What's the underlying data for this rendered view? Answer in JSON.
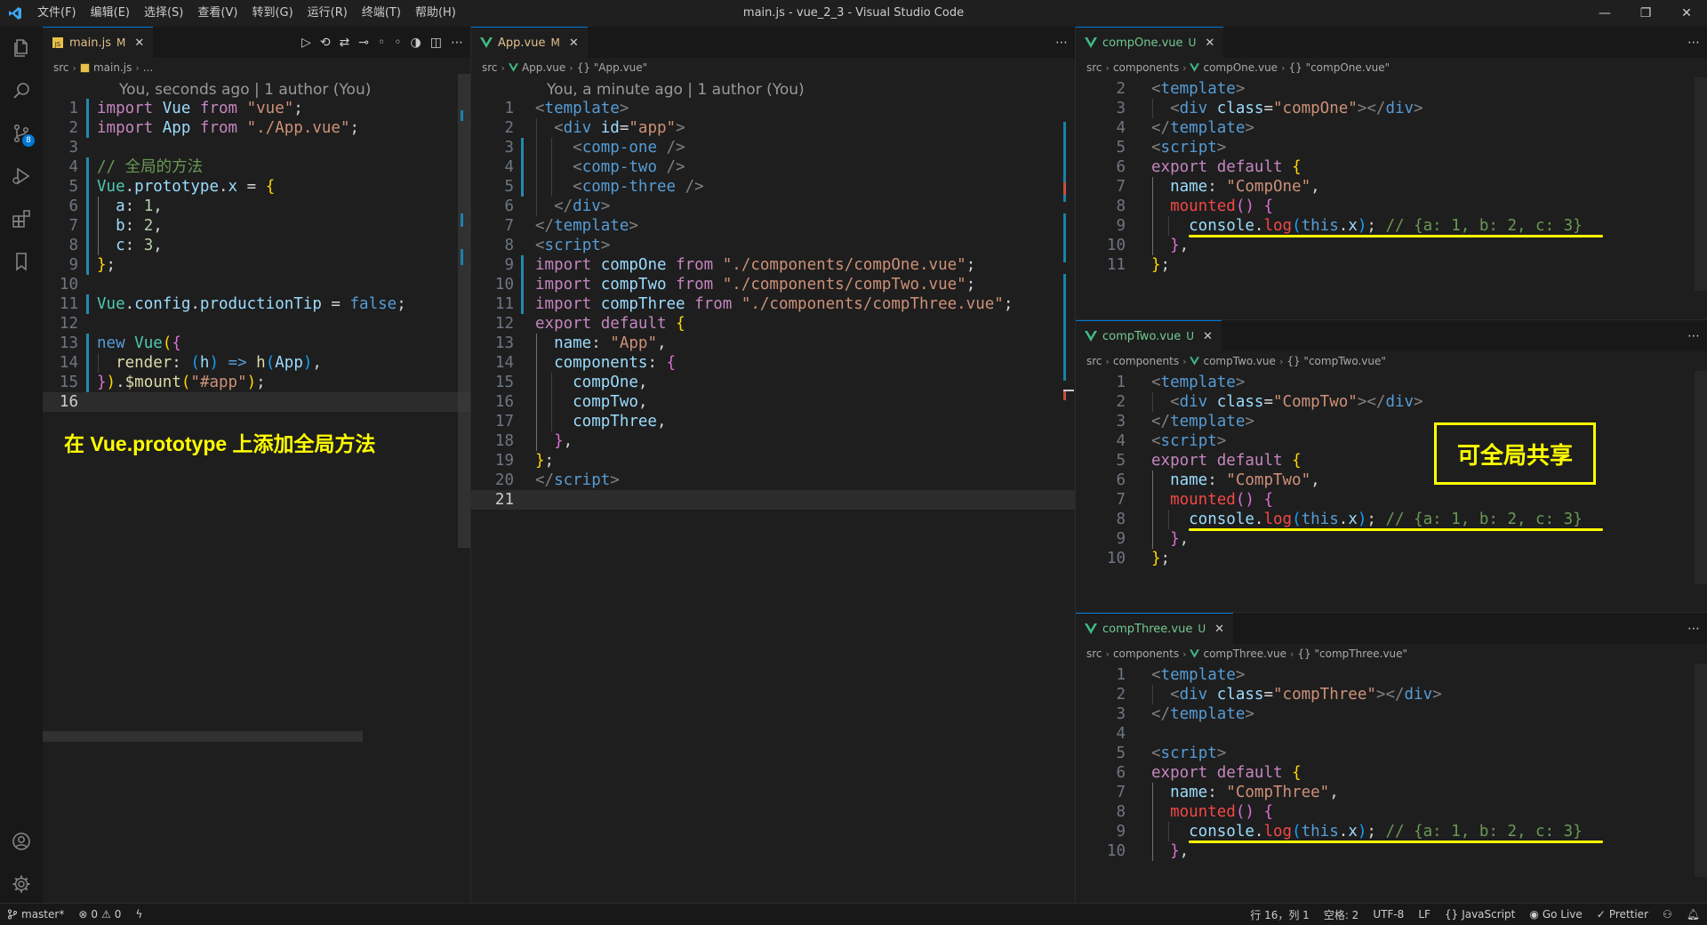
{
  "titlebar": {
    "menu": [
      "文件(F)",
      "编辑(E)",
      "选择(S)",
      "查看(V)",
      "转到(G)",
      "运行(R)",
      "终端(T)",
      "帮助(H)"
    ],
    "title": "main.js - vue_2_3 - Visual Studio Code",
    "minimize": "—",
    "maximize": "❐",
    "close": "✕"
  },
  "activity": {
    "icons": [
      "files-icon",
      "search-icon",
      "source-control-icon",
      "run-debug-icon",
      "extensions-icon",
      "bookmark-icon",
      "account-icon",
      "settings-gear-icon"
    ],
    "scm_badge": "8"
  },
  "left": {
    "tab": {
      "name": "main.js",
      "status": "M",
      "close": "✕"
    },
    "crumbs": [
      "src",
      "main.js",
      "..."
    ],
    "lens": "You, seconds ago | 1 author (You)",
    "lines": [
      [
        [
          "import ",
          "t-kw"
        ],
        [
          "Vue ",
          "t-var"
        ],
        [
          "from ",
          "t-kw"
        ],
        [
          "\"vue\"",
          "t-str"
        ],
        [
          ";",
          "t-w"
        ]
      ],
      [
        [
          "import ",
          "t-kw"
        ],
        [
          "App ",
          "t-var"
        ],
        [
          "from ",
          "t-kw"
        ],
        [
          "\"./App.vue\"",
          "t-str"
        ],
        [
          ";",
          "t-w"
        ]
      ],
      [],
      [
        [
          "// 全局的方法",
          "t-com"
        ]
      ],
      [
        [
          "Vue",
          "t-ty"
        ],
        [
          ".",
          "t-w"
        ],
        [
          "prototype",
          "t-var"
        ],
        [
          ".",
          "t-w"
        ],
        [
          "x",
          "t-var"
        ],
        [
          " = ",
          "t-w"
        ],
        [
          "{",
          "t-y"
        ]
      ],
      [
        [
          "  a",
          "t-var"
        ],
        [
          ": ",
          "t-w"
        ],
        [
          "1",
          "t-num"
        ],
        [
          ",",
          "t-w"
        ]
      ],
      [
        [
          "  b",
          "t-var"
        ],
        [
          ": ",
          "t-w"
        ],
        [
          "2",
          "t-num"
        ],
        [
          ",",
          "t-w"
        ]
      ],
      [
        [
          "  c",
          "t-var"
        ],
        [
          ": ",
          "t-w"
        ],
        [
          "3",
          "t-num"
        ],
        [
          ",",
          "t-w"
        ]
      ],
      [
        [
          "}",
          "t-y"
        ],
        [
          ";",
          "t-w"
        ]
      ],
      [],
      [
        [
          "Vue",
          "t-ty"
        ],
        [
          ".",
          "t-w"
        ],
        [
          "config",
          "t-var"
        ],
        [
          ".",
          "t-w"
        ],
        [
          "productionTip",
          "t-var"
        ],
        [
          " = ",
          "t-w"
        ],
        [
          "false",
          "t-blue"
        ],
        [
          ";",
          "t-w"
        ]
      ],
      [],
      [
        [
          "new ",
          "t-blue"
        ],
        [
          "Vue",
          "t-ty"
        ],
        [
          "(",
          "t-y"
        ],
        [
          "{",
          "t-pk"
        ]
      ],
      [
        [
          "  render",
          "t-fn"
        ],
        [
          ": ",
          "t-w"
        ],
        [
          "(",
          "t-bl"
        ],
        [
          "h",
          "t-var"
        ],
        [
          ")",
          "t-bl"
        ],
        [
          " => ",
          "t-blue"
        ],
        [
          "h",
          "t-fn"
        ],
        [
          "(",
          "t-bl"
        ],
        [
          "App",
          "t-var"
        ],
        [
          ")",
          "t-bl"
        ],
        [
          ",",
          "t-w"
        ]
      ],
      [
        [
          "}",
          "t-pk"
        ],
        [
          ")",
          "t-y"
        ],
        [
          ".",
          "t-w"
        ],
        [
          "$mount",
          "t-fn"
        ],
        [
          "(",
          "t-y"
        ],
        [
          "\"#app\"",
          "t-str"
        ],
        [
          ")",
          "t-y"
        ],
        [
          ";",
          "t-w"
        ]
      ],
      []
    ],
    "current_line": 16,
    "annotation": "在 Vue.prototype 上添加全局方法"
  },
  "middle": {
    "tab": {
      "name": "App.vue",
      "status": "M",
      "close": "✕"
    },
    "crumbs": [
      "src",
      "App.vue",
      "{} \"App.vue\""
    ],
    "lens": "You, a minute ago | 1 author (You)",
    "lines": [
      [
        [
          "<",
          "t-br"
        ],
        [
          "template",
          "t-tag"
        ],
        [
          ">",
          "t-br"
        ]
      ],
      [
        [
          "  <",
          "t-br"
        ],
        [
          "div ",
          "t-tag"
        ],
        [
          "id",
          "t-attr"
        ],
        [
          "=",
          "t-w"
        ],
        [
          "\"app\"",
          "t-str"
        ],
        [
          ">",
          "t-br"
        ]
      ],
      [
        [
          "    <",
          "t-br"
        ],
        [
          "comp-one ",
          "t-tag"
        ],
        [
          "/>",
          "t-br"
        ]
      ],
      [
        [
          "    <",
          "t-br"
        ],
        [
          "comp-two ",
          "t-tag"
        ],
        [
          "/>",
          "t-br"
        ]
      ],
      [
        [
          "    <",
          "t-br"
        ],
        [
          "comp-three ",
          "t-tag"
        ],
        [
          "/>",
          "t-br"
        ]
      ],
      [
        [
          "  </",
          "t-br"
        ],
        [
          "div",
          "t-tag"
        ],
        [
          ">",
          "t-br"
        ]
      ],
      [
        [
          "</",
          "t-br"
        ],
        [
          "template",
          "t-tag"
        ],
        [
          ">",
          "t-br"
        ]
      ],
      [
        [
          "<",
          "t-br"
        ],
        [
          "script",
          "t-tag"
        ],
        [
          ">",
          "t-br"
        ]
      ],
      [
        [
          "import ",
          "t-kw"
        ],
        [
          "compOne ",
          "t-var"
        ],
        [
          "from ",
          "t-kw"
        ],
        [
          "\"./components/compOne.vue\"",
          "t-str"
        ],
        [
          ";",
          "t-w"
        ]
      ],
      [
        [
          "import ",
          "t-kw"
        ],
        [
          "compTwo ",
          "t-var"
        ],
        [
          "from ",
          "t-kw"
        ],
        [
          "\"./components/compTwo.vue\"",
          "t-str"
        ],
        [
          ";",
          "t-w"
        ]
      ],
      [
        [
          "import ",
          "t-kw"
        ],
        [
          "compThree ",
          "t-var"
        ],
        [
          "from ",
          "t-kw"
        ],
        [
          "\"./components/compThree.vue\"",
          "t-str"
        ],
        [
          ";",
          "t-w"
        ]
      ],
      [
        [
          "export ",
          "t-kw"
        ],
        [
          "default ",
          "t-kw"
        ],
        [
          "{",
          "t-y"
        ]
      ],
      [
        [
          "  name",
          "t-var"
        ],
        [
          ": ",
          "t-w"
        ],
        [
          "\"App\"",
          "t-str"
        ],
        [
          ",",
          "t-w"
        ]
      ],
      [
        [
          "  components",
          "t-var"
        ],
        [
          ": ",
          "t-w"
        ],
        [
          "{",
          "t-pk"
        ]
      ],
      [
        [
          "    compOne",
          "t-var"
        ],
        [
          ",",
          "t-w"
        ]
      ],
      [
        [
          "    compTwo",
          "t-var"
        ],
        [
          ",",
          "t-w"
        ]
      ],
      [
        [
          "    compThree",
          "t-var"
        ],
        [
          ",",
          "t-w"
        ]
      ],
      [
        [
          "  }",
          "t-pk"
        ],
        [
          ",",
          "t-w"
        ]
      ],
      [
        [
          "}",
          "t-y"
        ],
        [
          ";",
          "t-w"
        ]
      ],
      [
        [
          "</",
          "t-br"
        ],
        [
          "script",
          "t-tag"
        ],
        [
          ">",
          "t-br"
        ]
      ],
      []
    ],
    "current_line": 21
  },
  "right": {
    "panes": [
      {
        "tab": {
          "name": "compOne.vue",
          "status": "U",
          "close": "✕"
        },
        "crumbs": [
          "src",
          "components",
          "compOne.vue",
          "{} \"compOne.vue\""
        ],
        "start": 2,
        "lines": [
          [
            [
              "<",
              "t-br"
            ],
            [
              "template",
              "t-tag"
            ],
            [
              ">",
              "t-br"
            ]
          ],
          [
            [
              "  <",
              "t-br"
            ],
            [
              "div ",
              "t-tag"
            ],
            [
              "class",
              "t-attr"
            ],
            [
              "=",
              "t-w"
            ],
            [
              "\"compOne\"",
              "t-str"
            ],
            [
              "></",
              "t-br"
            ],
            [
              "div",
              "t-tag"
            ],
            [
              ">",
              "t-br"
            ]
          ],
          [
            [
              "</",
              "t-br"
            ],
            [
              "template",
              "t-tag"
            ],
            [
              ">",
              "t-br"
            ]
          ],
          [
            [
              "<",
              "t-br"
            ],
            [
              "script",
              "t-tag"
            ],
            [
              ">",
              "t-br"
            ]
          ],
          [
            [
              "export ",
              "t-kw"
            ],
            [
              "default ",
              "t-kw"
            ],
            [
              "{",
              "t-y"
            ]
          ],
          [
            [
              "  name",
              "t-var"
            ],
            [
              ": ",
              "t-w"
            ],
            [
              "\"CompOne\"",
              "t-str"
            ],
            [
              ",",
              "t-w"
            ]
          ],
          [
            [
              "  mounted",
              "t-red"
            ],
            [
              "() ",
              "t-pk"
            ],
            [
              "{",
              "t-pk"
            ]
          ],
          [
            [
              "    console",
              "t-var"
            ],
            [
              ".",
              "t-w"
            ],
            [
              "log",
              "t-red"
            ],
            [
              "(",
              "t-bl"
            ],
            [
              "this",
              "t-blue"
            ],
            [
              ".",
              "t-w"
            ],
            [
              "x",
              "t-var"
            ],
            [
              ")",
              "t-bl"
            ],
            [
              "; ",
              "t-w"
            ],
            [
              "// {a: 1, b: 2, c: 3}",
              "t-com"
            ]
          ],
          [
            [
              "  }",
              "t-pk"
            ],
            [
              ",",
              "t-w"
            ]
          ],
          [
            [
              "}",
              "t-y"
            ],
            [
              ";",
              "t-w"
            ]
          ]
        ]
      },
      {
        "tab": {
          "name": "compTwo.vue",
          "status": "U",
          "close": "✕"
        },
        "crumbs": [
          "src",
          "components",
          "compTwo.vue",
          "{} \"compTwo.vue\""
        ],
        "start": 1,
        "lines": [
          [
            [
              "<",
              "t-br"
            ],
            [
              "template",
              "t-tag"
            ],
            [
              ">",
              "t-br"
            ]
          ],
          [
            [
              "  <",
              "t-br"
            ],
            [
              "div ",
              "t-tag"
            ],
            [
              "class",
              "t-attr"
            ],
            [
              "=",
              "t-w"
            ],
            [
              "\"CompTwo\"",
              "t-str"
            ],
            [
              "></",
              "t-br"
            ],
            [
              "div",
              "t-tag"
            ],
            [
              ">",
              "t-br"
            ]
          ],
          [
            [
              "</",
              "t-br"
            ],
            [
              "template",
              "t-tag"
            ],
            [
              ">",
              "t-br"
            ]
          ],
          [
            [
              "<",
              "t-br"
            ],
            [
              "script",
              "t-tag"
            ],
            [
              ">",
              "t-br"
            ]
          ],
          [
            [
              "export ",
              "t-kw"
            ],
            [
              "default ",
              "t-kw"
            ],
            [
              "{",
              "t-y"
            ]
          ],
          [
            [
              "  name",
              "t-var"
            ],
            [
              ": ",
              "t-w"
            ],
            [
              "\"CompTwo\"",
              "t-str"
            ],
            [
              ",",
              "t-w"
            ]
          ],
          [
            [
              "  mounted",
              "t-red"
            ],
            [
              "() ",
              "t-pk"
            ],
            [
              "{",
              "t-pk"
            ]
          ],
          [
            [
              "    console",
              "t-var"
            ],
            [
              ".",
              "t-w"
            ],
            [
              "log",
              "t-red"
            ],
            [
              "(",
              "t-bl"
            ],
            [
              "this",
              "t-blue"
            ],
            [
              ".",
              "t-w"
            ],
            [
              "x",
              "t-var"
            ],
            [
              ")",
              "t-bl"
            ],
            [
              "; ",
              "t-w"
            ],
            [
              "// {a: 1, b: 2, c: 3}",
              "t-com"
            ]
          ],
          [
            [
              "  }",
              "t-pk"
            ],
            [
              ",",
              "t-w"
            ]
          ],
          [
            [
              "}",
              "t-y"
            ],
            [
              ";",
              "t-w"
            ]
          ]
        ]
      },
      {
        "tab": {
          "name": "compThree.vue",
          "status": "U",
          "close": "✕"
        },
        "crumbs": [
          "src",
          "components",
          "compThree.vue",
          "{} \"compThree.vue\""
        ],
        "start": 1,
        "lines": [
          [
            [
              "<",
              "t-br"
            ],
            [
              "template",
              "t-tag"
            ],
            [
              ">",
              "t-br"
            ]
          ],
          [
            [
              "  <",
              "t-br"
            ],
            [
              "div ",
              "t-tag"
            ],
            [
              "class",
              "t-attr"
            ],
            [
              "=",
              "t-w"
            ],
            [
              "\"compThree\"",
              "t-str"
            ],
            [
              "></",
              "t-br"
            ],
            [
              "div",
              "t-tag"
            ],
            [
              ">",
              "t-br"
            ]
          ],
          [
            [
              "</",
              "t-br"
            ],
            [
              "template",
              "t-tag"
            ],
            [
              ">",
              "t-br"
            ]
          ],
          [],
          [
            [
              "<",
              "t-br"
            ],
            [
              "script",
              "t-tag"
            ],
            [
              ">",
              "t-br"
            ]
          ],
          [
            [
              "export ",
              "t-kw"
            ],
            [
              "default ",
              "t-kw"
            ],
            [
              "{",
              "t-y"
            ]
          ],
          [
            [
              "  name",
              "t-var"
            ],
            [
              ": ",
              "t-w"
            ],
            [
              "\"CompThree\"",
              "t-str"
            ],
            [
              ",",
              "t-w"
            ]
          ],
          [
            [
              "  mounted",
              "t-red"
            ],
            [
              "() ",
              "t-pk"
            ],
            [
              "{",
              "t-pk"
            ]
          ],
          [
            [
              "    console",
              "t-var"
            ],
            [
              ".",
              "t-w"
            ],
            [
              "log",
              "t-red"
            ],
            [
              "(",
              "t-bl"
            ],
            [
              "this",
              "t-blue"
            ],
            [
              ".",
              "t-w"
            ],
            [
              "x",
              "t-var"
            ],
            [
              ")",
              "t-bl"
            ],
            [
              "; ",
              "t-w"
            ],
            [
              "// {a: 1, b: 2, c: 3}",
              "t-com"
            ]
          ],
          [
            [
              "  }",
              "t-pk"
            ],
            [
              ",",
              "t-w"
            ]
          ]
        ]
      }
    ],
    "annotation": "可全局共享"
  },
  "statusbar": {
    "branch": "master*",
    "problems": "0",
    "warnings": "0",
    "position": "行 16，列 1",
    "spaces": "空格: 2",
    "encoding": "UTF-8",
    "eol": "LF",
    "language": "JavaScript",
    "golive": "Go Live",
    "prettier": "Prettier"
  },
  "colors": {
    "accent": "#0078d4",
    "annotation": "#ffff00",
    "modified": "#e2c08d",
    "untracked": "#73c991"
  }
}
